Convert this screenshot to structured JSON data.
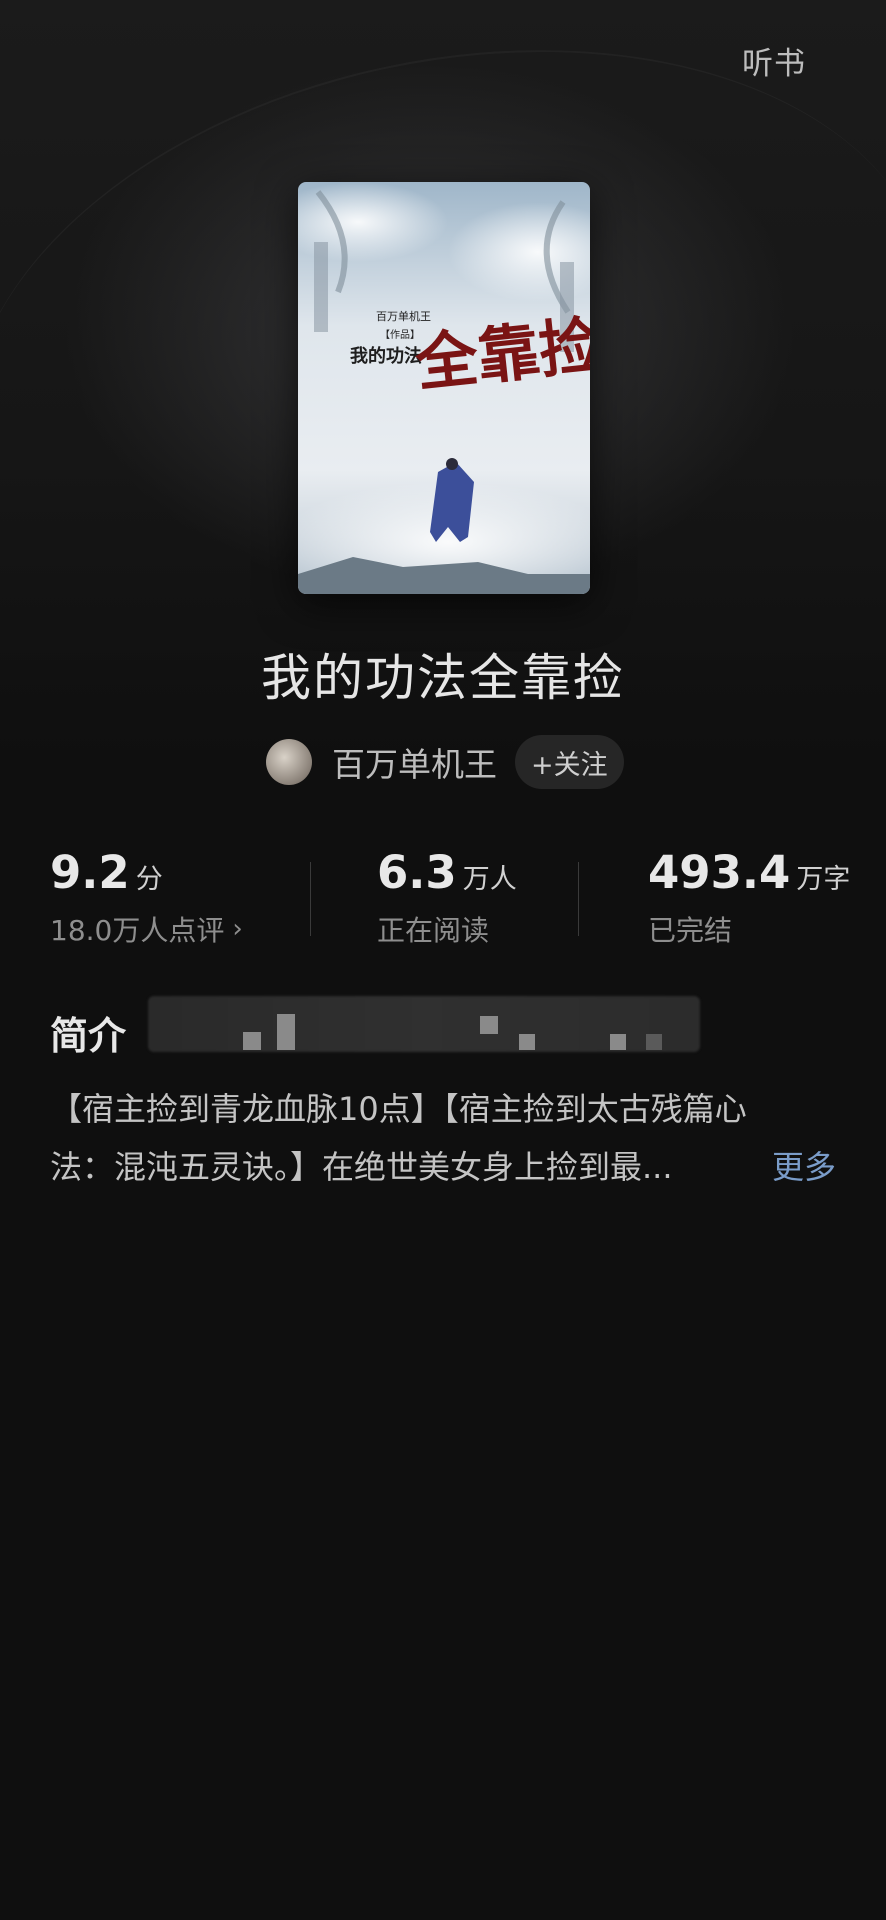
{
  "header": {
    "listen_label": "听书"
  },
  "book": {
    "cover": {
      "title_small": "我的功法",
      "title_large": "全靠捡",
      "author_line": "百万单机王",
      "work_tag": "【作品】"
    },
    "title": "我的功法全靠捡",
    "author": "百万单机王",
    "follow_label": "+关注"
  },
  "stats": {
    "rating": {
      "value": "9.2",
      "unit": "分",
      "sub": "18.0万人点评"
    },
    "readers": {
      "value": "6.3",
      "unit": "万人",
      "sub": "正在阅读"
    },
    "words": {
      "value": "493.4",
      "unit": "万字",
      "sub": "已完结"
    }
  },
  "intro": {
    "header": "简介",
    "line1": "【宿主捡到青龙血脉10点】【宿主捡到太古残篇心",
    "line2": "法：混沌五灵诀。】在绝世美女身上捡到最...",
    "more_label": "更多"
  },
  "colors": {
    "background": "#0f0f0f",
    "link": "#7a9cc9"
  },
  "icons": {
    "chevron": "chevron-right-icon"
  }
}
